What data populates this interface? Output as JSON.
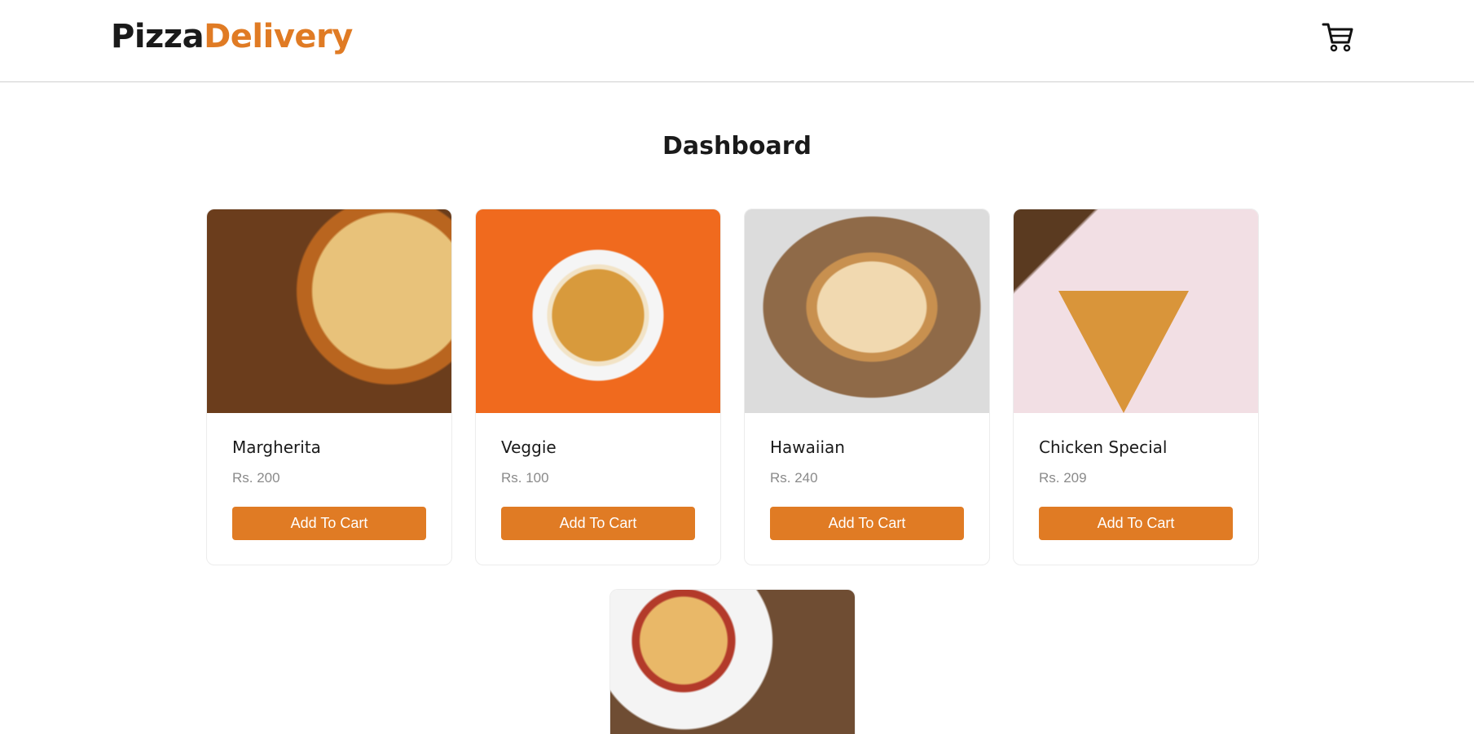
{
  "brand": {
    "name_part1": "Pizza",
    "name_part2": "Delivery",
    "accent_color": "#e07b24"
  },
  "header": {
    "cart_icon": "cart-icon"
  },
  "main": {
    "title": "Dashboard",
    "products": [
      {
        "name": "Margherita",
        "price": "Rs. 200",
        "button_label": "Add To Cart"
      },
      {
        "name": "Veggie",
        "price": "Rs. 100",
        "button_label": "Add To Cart"
      },
      {
        "name": "Hawaiian",
        "price": "Rs. 240",
        "button_label": "Add To Cart"
      },
      {
        "name": "Chicken Special",
        "price": "Rs. 209",
        "button_label": "Add To Cart"
      },
      {
        "name": "",
        "price": "",
        "button_label": ""
      }
    ]
  }
}
